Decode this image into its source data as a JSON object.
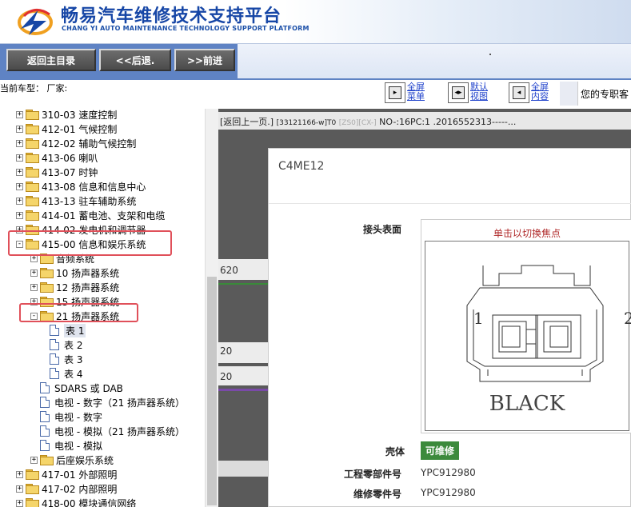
{
  "header": {
    "title_cn": "畅易汽车维修技术支持平台",
    "title_en": "CHANG YI AUTO MAINTENANCE TECHNOLOGY SUPPORT PLATFORM"
  },
  "toolbar": {
    "home_label": "返回主目录",
    "back_label": "<<后退.",
    "forward_label": ">>前进"
  },
  "info": {
    "current_model": "当前车型：  厂家:",
    "fullscreen_menu": "全屏菜单",
    "default_view": "默认视图",
    "fullscreen_content": "全屏内容",
    "expert_label": "您的专职客"
  },
  "tree": {
    "items": [
      {
        "label": "310-03 速度控制",
        "kind": "folder",
        "expander": "+"
      },
      {
        "label": "412-01 气候控制",
        "kind": "folder",
        "expander": "+"
      },
      {
        "label": "412-02 辅助气候控制",
        "kind": "folder",
        "expander": "+"
      },
      {
        "label": "413-06 喇叭",
        "kind": "folder",
        "expander": "+"
      },
      {
        "label": "413-07 时钟",
        "kind": "folder",
        "expander": "+"
      },
      {
        "label": "413-08 信息和信息中心",
        "kind": "folder",
        "expander": "+"
      },
      {
        "label": "413-13 驻车辅助系统",
        "kind": "folder",
        "expander": "+"
      },
      {
        "label": "414-01 蓄电池、支架和电缆",
        "kind": "folder",
        "expander": "+"
      },
      {
        "label": "414-02 发电机和调节器",
        "kind": "folder",
        "expander": "+"
      },
      {
        "label": "415-00 信息和娱乐系统",
        "kind": "folder",
        "expander": "-"
      },
      {
        "label": "音频系统",
        "kind": "folder",
        "expander": "+"
      },
      {
        "label": "10 扬声器系统",
        "kind": "folder",
        "expander": "+"
      },
      {
        "label": "12 扬声器系统",
        "kind": "folder",
        "expander": "+"
      },
      {
        "label": "15 扬声器系统",
        "kind": "folder",
        "expander": "+"
      },
      {
        "label": "21 扬声器系统",
        "kind": "folder",
        "expander": "-"
      },
      {
        "label": "表 1",
        "kind": "doc",
        "selected": true
      },
      {
        "label": "表 2",
        "kind": "doc"
      },
      {
        "label": "表 3",
        "kind": "doc"
      },
      {
        "label": "表 4",
        "kind": "doc"
      },
      {
        "label": "SDARS 或 DAB",
        "kind": "doc"
      },
      {
        "label": "电视 - 数字（21 扬声器系统）",
        "kind": "doc"
      },
      {
        "label": "电视 - 数字",
        "kind": "doc"
      },
      {
        "label": "电视 - 模拟（21 扬声器系统）",
        "kind": "doc"
      },
      {
        "label": "电视 - 模拟",
        "kind": "doc"
      },
      {
        "label": "后座娱乐系统",
        "kind": "folder",
        "expander": "+"
      },
      {
        "label": "417-01 外部照明",
        "kind": "folder",
        "expander": "+"
      },
      {
        "label": "417-02 内部照明",
        "kind": "folder",
        "expander": "+"
      },
      {
        "label": "418-00 模块通信网络",
        "kind": "folder",
        "expander": "+"
      }
    ]
  },
  "main": {
    "back_link": "[返回上一页.]",
    "doc_id": "[33121166-w]T0",
    "doc_code": "[ZS0][CX-]",
    "doc_info": "NO-:16PC:1 .2016552313-----...",
    "band_labels": [
      "620",
      "20",
      "20"
    ]
  },
  "dialog": {
    "title": "C4ME12",
    "connector_face_label": "接头表面",
    "diagram_hint": "单击以切换焦点",
    "pin_left": "1",
    "pin_right": "2",
    "color_text": "BLACK",
    "housing_label": "壳体",
    "repairable": "可维修",
    "eng_part_label": "工程零部件号",
    "eng_part_value": "YPC912980",
    "service_part_label": "维修零件号",
    "service_part_value": "YPC912980"
  },
  "colors": {
    "brand_blue": "#1646a6",
    "toolbar_blue": "#5f83c4",
    "highlight_red": "#e0505a",
    "repairable_green": "#3c8a3c"
  }
}
